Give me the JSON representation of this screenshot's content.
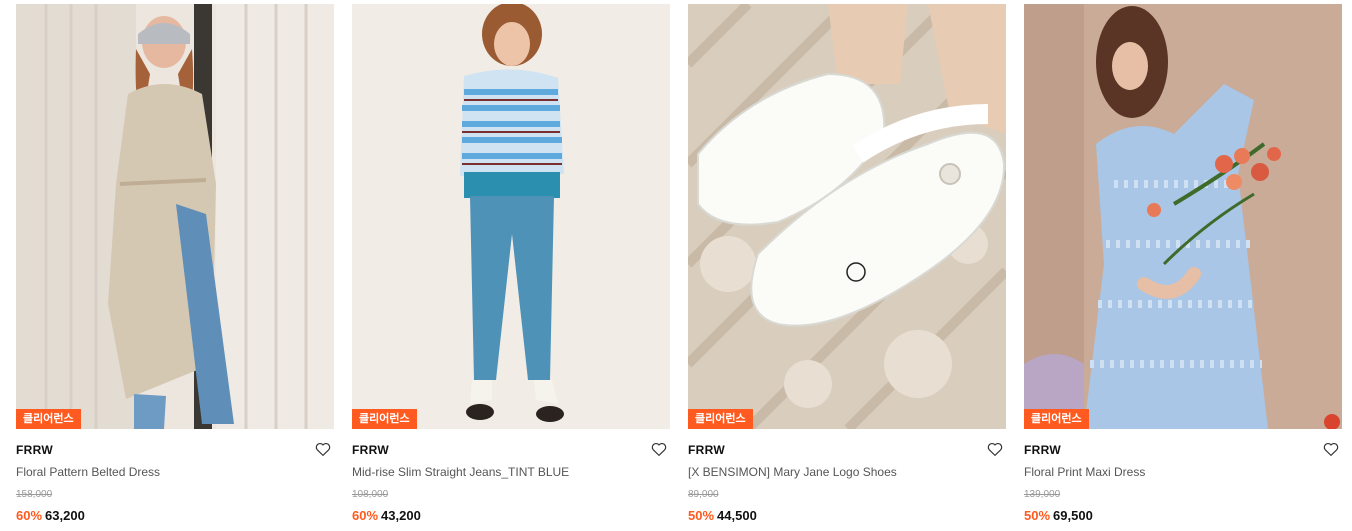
{
  "products": [
    {
      "badge": "클리어런스",
      "brand": "FRRW",
      "name": "Floral Pattern Belted Dress",
      "original_price": "158,000",
      "discount": "60%",
      "sale_price": "63,200"
    },
    {
      "badge": "클리어런스",
      "brand": "FRRW",
      "name": "Mid-rise Slim Straight Jeans_TINT BLUE",
      "original_price": "108,000",
      "discount": "60%",
      "sale_price": "43,200"
    },
    {
      "badge": "클리어런스",
      "brand": "FRRW",
      "name": "[X BENSIMON] Mary Jane Logo Shoes",
      "original_price": "89,000",
      "discount": "50%",
      "sale_price": "44,500"
    },
    {
      "badge": "클리어런스",
      "brand": "FRRW",
      "name": "Floral Print Maxi Dress",
      "original_price": "139,000",
      "discount": "50%",
      "sale_price": "69,500"
    }
  ],
  "icons": {
    "wishlist": "heart-outline-icon"
  },
  "colors": {
    "accent": "#ff5a1f",
    "brand_text": "#111111",
    "strike_price": "#9a9a9a"
  }
}
